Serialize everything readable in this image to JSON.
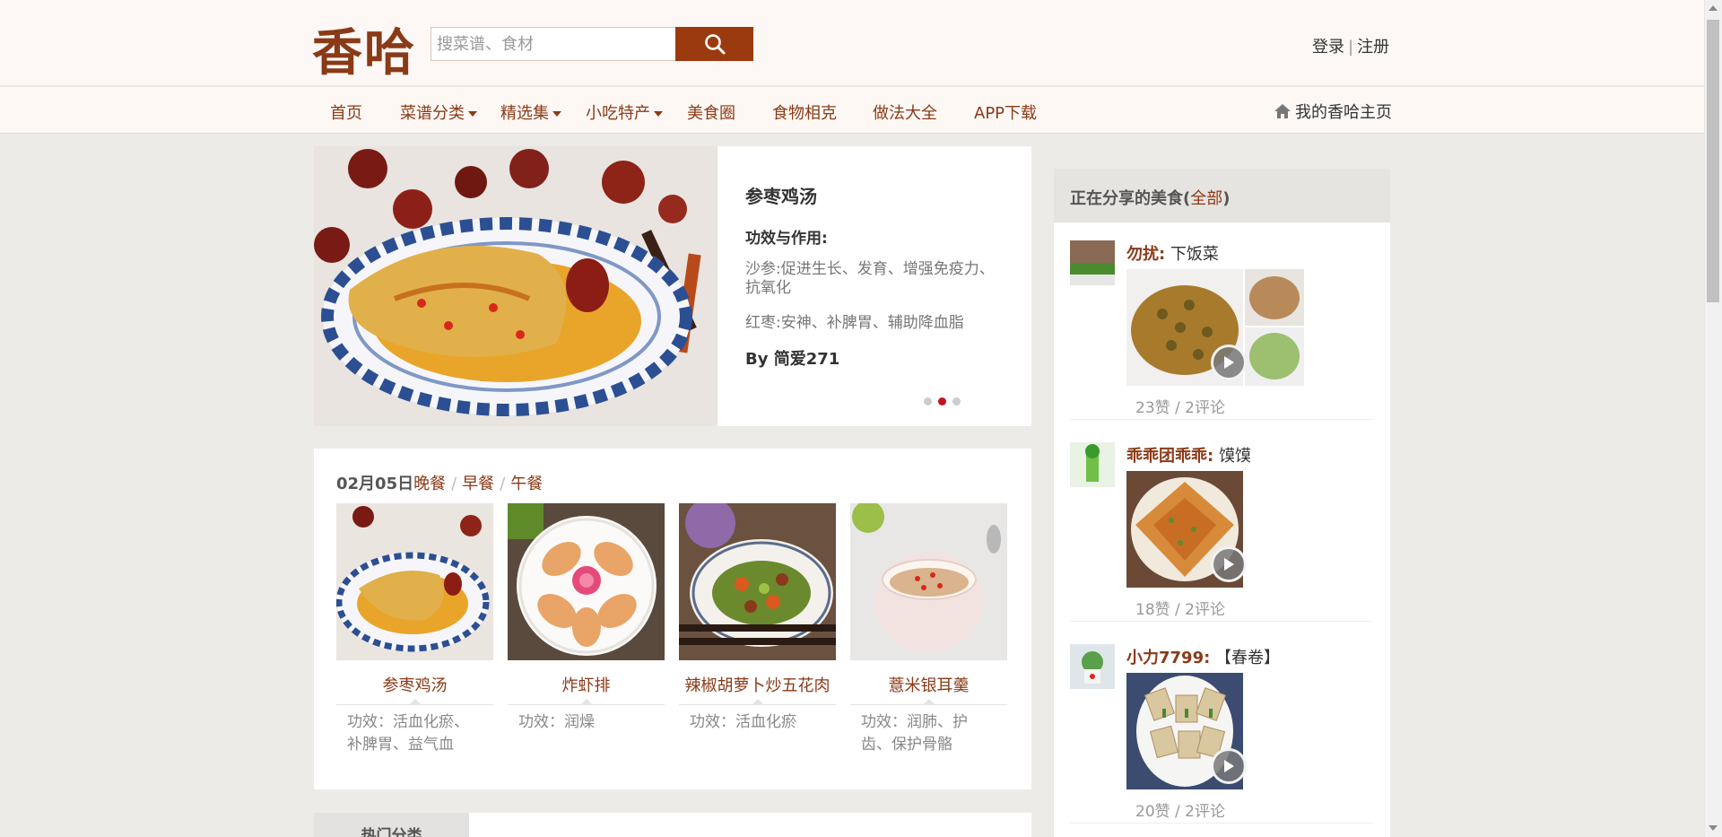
{
  "brand": {
    "logo_text": "香哈"
  },
  "search": {
    "placeholder": "搜菜谱、食材"
  },
  "auth": {
    "login": "登录",
    "separator": "|",
    "register": "注册"
  },
  "nav": {
    "items": [
      {
        "label": "首页",
        "has_dropdown": false
      },
      {
        "label": "菜谱分类",
        "has_dropdown": true
      },
      {
        "label": "精选集",
        "has_dropdown": true
      },
      {
        "label": "小吃特产",
        "has_dropdown": true
      },
      {
        "label": "美食圈",
        "has_dropdown": false
      },
      {
        "label": "食物相克",
        "has_dropdown": false
      },
      {
        "label": "做法大全",
        "has_dropdown": false
      },
      {
        "label": "APP下载",
        "has_dropdown": false
      }
    ],
    "my_home": "我的香哈主页"
  },
  "hero": {
    "title": "参枣鸡汤",
    "effect_label": "功效与作用:",
    "effects": [
      "沙参:促进生长、发育、增强免疫力、抗氧化",
      "红枣:安神、补脾胃、辅助降血脂"
    ],
    "author": "By 简爱271",
    "slides": 3,
    "active_slide": 2
  },
  "daily": {
    "date": "02月05日",
    "tabs": [
      "晚餐",
      "早餐",
      "午餐"
    ],
    "tab_separator": "/",
    "dishes": [
      {
        "name": "参枣鸡汤",
        "effect": "功效：活血化瘀、补脾胃、益气血"
      },
      {
        "name": "炸虾排",
        "effect": "功效：润燥"
      },
      {
        "name": "辣椒胡萝卜炒五花肉",
        "effect": "功效：活血化瘀"
      },
      {
        "name": "薏米银耳羹",
        "effect": "功效：润肺、护齿、保护骨骼"
      }
    ]
  },
  "hot": {
    "tab": "热门分类"
  },
  "sidebar": {
    "title": "正在分享的美食",
    "all_link": "全部",
    "posts": [
      {
        "user": "勿扰:",
        "dish": "下饭菜",
        "stats": "23赞 / 2评论"
      },
      {
        "user": "乖乖团乖乖:",
        "dish": "馍馍",
        "stats": "18赞 / 2评论"
      },
      {
        "user": "小力7799:",
        "dish": "【春卷】",
        "stats": "20赞 / 2评论"
      }
    ]
  },
  "colors": {
    "brand": "#8a3a17",
    "search_button": "#9c3a0f",
    "active_dot": "#c3141d"
  }
}
